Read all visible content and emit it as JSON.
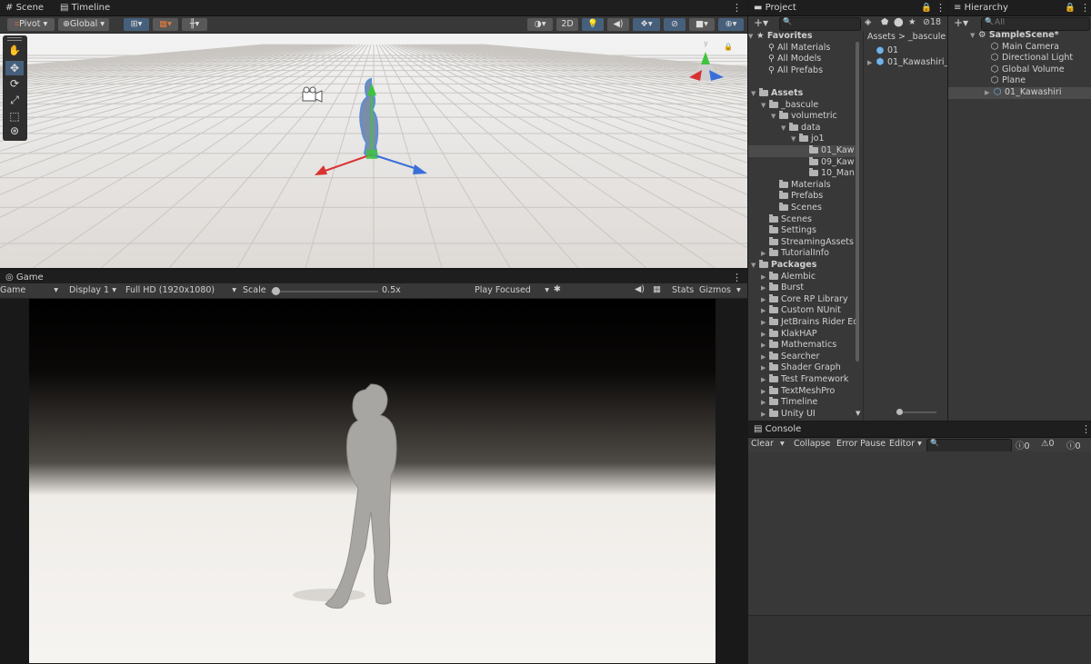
{
  "scene": {
    "tabs": [
      "Scene",
      "Timeline"
    ],
    "toolbar": {
      "pivot": "Pivot",
      "global": "Global",
      "mode_2d": "2D"
    },
    "tools": [
      "hand-tool",
      "move-tool",
      "rotate-tool",
      "scale-tool",
      "rect-tool",
      "transform-tool"
    ],
    "axis_y_label": "y"
  },
  "game": {
    "tab": "Game",
    "view_select": "Game",
    "display": "Display 1",
    "resolution": "Full HD (1920x1080)",
    "scale_label": "Scale",
    "scale_value": "0.5x",
    "scale_fraction": 0.04,
    "play_mode": "Play Focused",
    "stats": "Stats",
    "gizmos": "Gizmos"
  },
  "project": {
    "tab": "Project",
    "favorites_label": "Favorites",
    "favorites": [
      "All Materials",
      "All Models",
      "All Prefabs"
    ],
    "hidden_count": "18",
    "breadcrumb": [
      "Assets",
      "_bascule"
    ],
    "tree": [
      {
        "label": "Assets",
        "depth": 0,
        "arrow": "down",
        "bold": true
      },
      {
        "label": "_bascule",
        "depth": 1,
        "arrow": "down"
      },
      {
        "label": "volumetric",
        "depth": 2,
        "arrow": "down"
      },
      {
        "label": "data",
        "depth": 3,
        "arrow": "down"
      },
      {
        "label": "jo1",
        "depth": 4,
        "arrow": "down"
      },
      {
        "label": "01_Kaw",
        "depth": 5,
        "arrow": "",
        "selected": true
      },
      {
        "label": "09_Kaw",
        "depth": 5,
        "arrow": ""
      },
      {
        "label": "10_Man",
        "depth": 5,
        "arrow": ""
      },
      {
        "label": "Materials",
        "depth": 2,
        "arrow": ""
      },
      {
        "label": "Prefabs",
        "depth": 2,
        "arrow": ""
      },
      {
        "label": "Scenes",
        "depth": 2,
        "arrow": ""
      },
      {
        "label": "Scenes",
        "depth": 1,
        "arrow": ""
      },
      {
        "label": "Settings",
        "depth": 1,
        "arrow": ""
      },
      {
        "label": "StreamingAssets",
        "depth": 1,
        "arrow": ""
      },
      {
        "label": "TutorialInfo",
        "depth": 1,
        "arrow": "right"
      },
      {
        "label": "Packages",
        "depth": 0,
        "arrow": "down",
        "bold": true
      },
      {
        "label": "Alembic",
        "depth": 1,
        "arrow": "right"
      },
      {
        "label": "Burst",
        "depth": 1,
        "arrow": "right"
      },
      {
        "label": "Core RP Library",
        "depth": 1,
        "arrow": "right"
      },
      {
        "label": "Custom NUnit",
        "depth": 1,
        "arrow": "right"
      },
      {
        "label": "JetBrains Rider Ed",
        "depth": 1,
        "arrow": "right"
      },
      {
        "label": "KlakHAP",
        "depth": 1,
        "arrow": "right"
      },
      {
        "label": "Mathematics",
        "depth": 1,
        "arrow": "right"
      },
      {
        "label": "Searcher",
        "depth": 1,
        "arrow": "right"
      },
      {
        "label": "Shader Graph",
        "depth": 1,
        "arrow": "right"
      },
      {
        "label": "Test Framework",
        "depth": 1,
        "arrow": "right"
      },
      {
        "label": "TextMeshPro",
        "depth": 1,
        "arrow": "right"
      },
      {
        "label": "Timeline",
        "depth": 1,
        "arrow": "right"
      },
      {
        "label": "Unity UI",
        "depth": 1,
        "arrow": "right"
      }
    ],
    "files": [
      {
        "label": "01",
        "icon": "sphere"
      },
      {
        "label": "01_Kawashiri_",
        "icon": "prefab"
      }
    ]
  },
  "hierarchy": {
    "tab": "Hierarchy",
    "search_placeholder": "All",
    "scene_name": "SampleScene*",
    "items": [
      "Main Camera",
      "Directional Light",
      "Global Volume",
      "Plane",
      "01_Kawashiri"
    ]
  },
  "console": {
    "tab": "Console",
    "clear": "Clear",
    "collapse": "Collapse",
    "error_pause": "Error Pause",
    "editor": "Editor",
    "counts": [
      "0",
      "0",
      "0"
    ]
  },
  "colors": {
    "accent": "#4a8cd6",
    "panel": "#383838",
    "dark": "#1e1e1e"
  }
}
